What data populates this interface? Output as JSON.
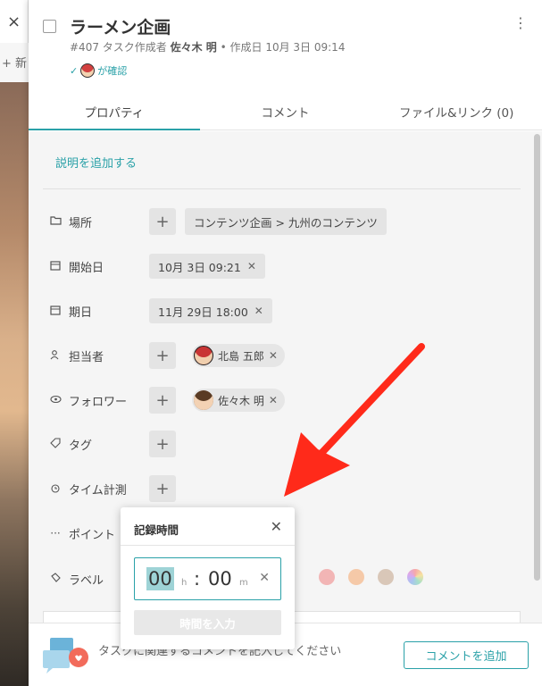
{
  "background": {
    "close_icon": "×",
    "new_label": "+ 新"
  },
  "header": {
    "title": "ラーメン企画",
    "meta_prefix": "#407 タスク作成者",
    "author": "佐々木 明",
    "meta_suffix": "• 作成日 10月 3日 09:14",
    "confirm_check": "✓",
    "confirm_label": "が確認"
  },
  "tabs": [
    {
      "label": "プロパティ",
      "active": true
    },
    {
      "label": "コメント",
      "active": false
    },
    {
      "label": "ファイル&リンク (0)",
      "active": false
    }
  ],
  "properties": {
    "add_description": "説明を追加する",
    "location": {
      "label": "場所",
      "icon": "folder-icon",
      "value": "コンテンツ企画 > 九州のコンテンツ"
    },
    "start_date": {
      "label": "開始日",
      "icon": "calendar-icon",
      "value": "10月 3日 09:21"
    },
    "due_date": {
      "label": "期日",
      "icon": "calendar-icon",
      "value": "11月 29日 18:00"
    },
    "assignee": {
      "label": "担当者",
      "icon": "person-icon",
      "value": "北島 五郎"
    },
    "follower": {
      "label": "フォロワー",
      "icon": "eye-icon",
      "value": "佐々木 明"
    },
    "tag": {
      "label": "タグ",
      "icon": "tag-icon"
    },
    "time_tracking": {
      "label": "タイム計測",
      "icon": "alarm-icon"
    },
    "points": {
      "label": "ポイント",
      "icon": "dots-icon"
    },
    "label": {
      "label": "ラベル",
      "icon": "palette-icon"
    }
  },
  "label_colors": [
    "#f2b5b5",
    "#f5c9a8",
    "#d9c7b8",
    "#c9b3e0"
  ],
  "time_popup": {
    "title": "記録時間",
    "hours": "00",
    "hours_unit": "h",
    "separator": ":",
    "minutes": "00",
    "minutes_unit": "m",
    "submit_label": "時間を入力"
  },
  "footer": {
    "prompt": "タスクに関連するコメントを記入してください",
    "button_label": "コメントを追加"
  },
  "colors": {
    "accent": "#2aa1a8",
    "arrow": "#ff2a1a"
  }
}
